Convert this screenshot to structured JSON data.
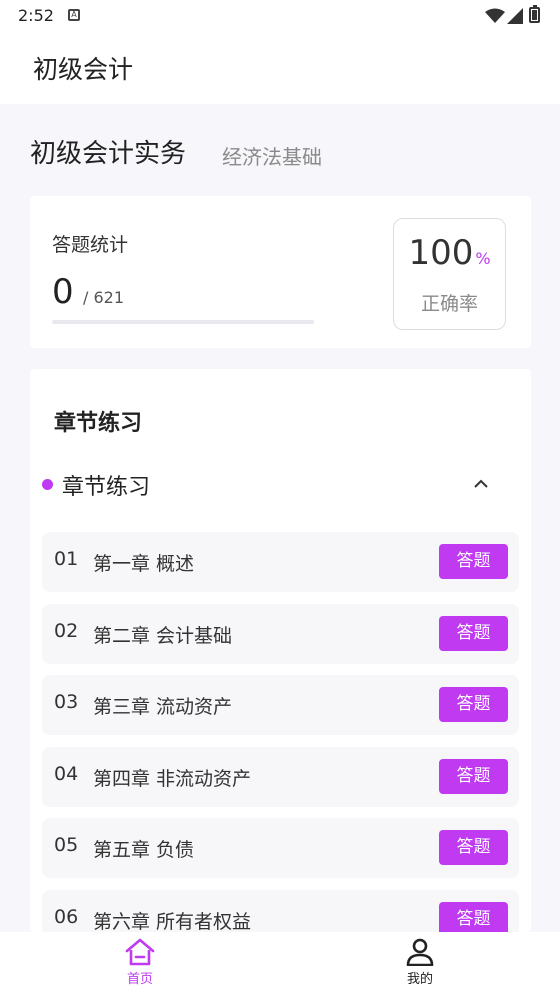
{
  "status_bar": {
    "time": "2:52",
    "notification_icon": "a-box-icon",
    "wifi_icon": "wifi-icon",
    "signal_icon": "signal-icon",
    "battery_icon": "battery-icon"
  },
  "app_bar": {
    "title": "初级会计"
  },
  "subjects": {
    "active": "初级会计实务",
    "inactive": "经济法基础"
  },
  "stats": {
    "label": "答题统计",
    "answered": "0",
    "total": "/ 621",
    "progress": 0,
    "rate_value": "100",
    "rate_unit": "%",
    "rate_label": "正确率"
  },
  "chapters": {
    "heading": "章节练习",
    "group_label": "章节练习",
    "button_label": "答题",
    "items": [
      {
        "num": "01",
        "name": "第一章 概述"
      },
      {
        "num": "02",
        "name": "第二章 会计基础"
      },
      {
        "num": "03",
        "name": "第三章 流动资产"
      },
      {
        "num": "04",
        "name": "第四章 非流动资产"
      },
      {
        "num": "05",
        "name": "第五章 负债"
      },
      {
        "num": "06",
        "name": "第六章 所有者权益"
      }
    ]
  },
  "tab_bar": {
    "home_label": "首页",
    "mine_label": "我的",
    "home_icon": "home-icon",
    "mine_icon": "user-icon"
  },
  "colors": {
    "accent": "#bf3af0"
  }
}
